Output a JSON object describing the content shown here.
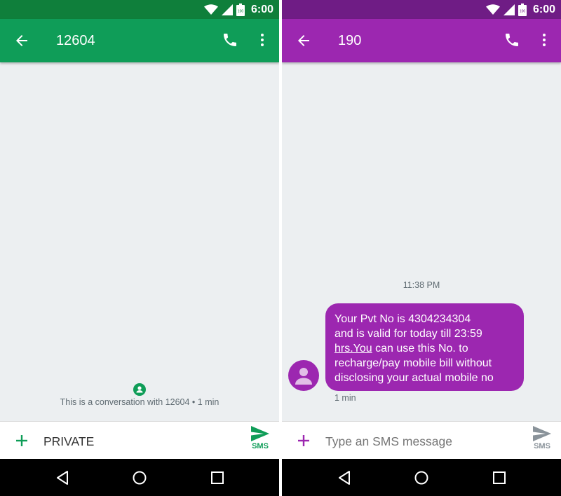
{
  "status_bar": {
    "time": "6:00",
    "battery_level": "100"
  },
  "left_screen": {
    "accent_color": "#0f9d58",
    "status_color": "#0f7f3b",
    "header": {
      "title": "12604"
    },
    "conversation_info": "This is a conversation with 12604 • 1 min",
    "composer": {
      "value": "PRIVATE",
      "send_label": "SMS"
    }
  },
  "right_screen": {
    "accent_color": "#9c27b0",
    "status_color": "#6f1c85",
    "header": {
      "title": "190"
    },
    "timestamp": "11:38 PM",
    "message": {
      "lines": [
        "Your Pvt No is 4304234304",
        "and is valid for today till 23:59",
        "hrs.You",
        " can use this No. to",
        "recharge/pay mobile bill without",
        "disclosing your actual mobile no"
      ],
      "time": "1 min"
    },
    "composer": {
      "placeholder": "Type an SMS message",
      "send_label": "SMS"
    }
  },
  "icons": {
    "back": "arrow-back-icon",
    "call": "phone-icon",
    "more": "more-vert-icon",
    "add": "plus-icon",
    "send": "send-icon",
    "wifi": "wifi-icon",
    "signal": "signal-icon",
    "battery": "battery-icon",
    "nav_back": "triangle-back-icon",
    "nav_home": "circle-home-icon",
    "nav_recents": "square-recents-icon"
  }
}
